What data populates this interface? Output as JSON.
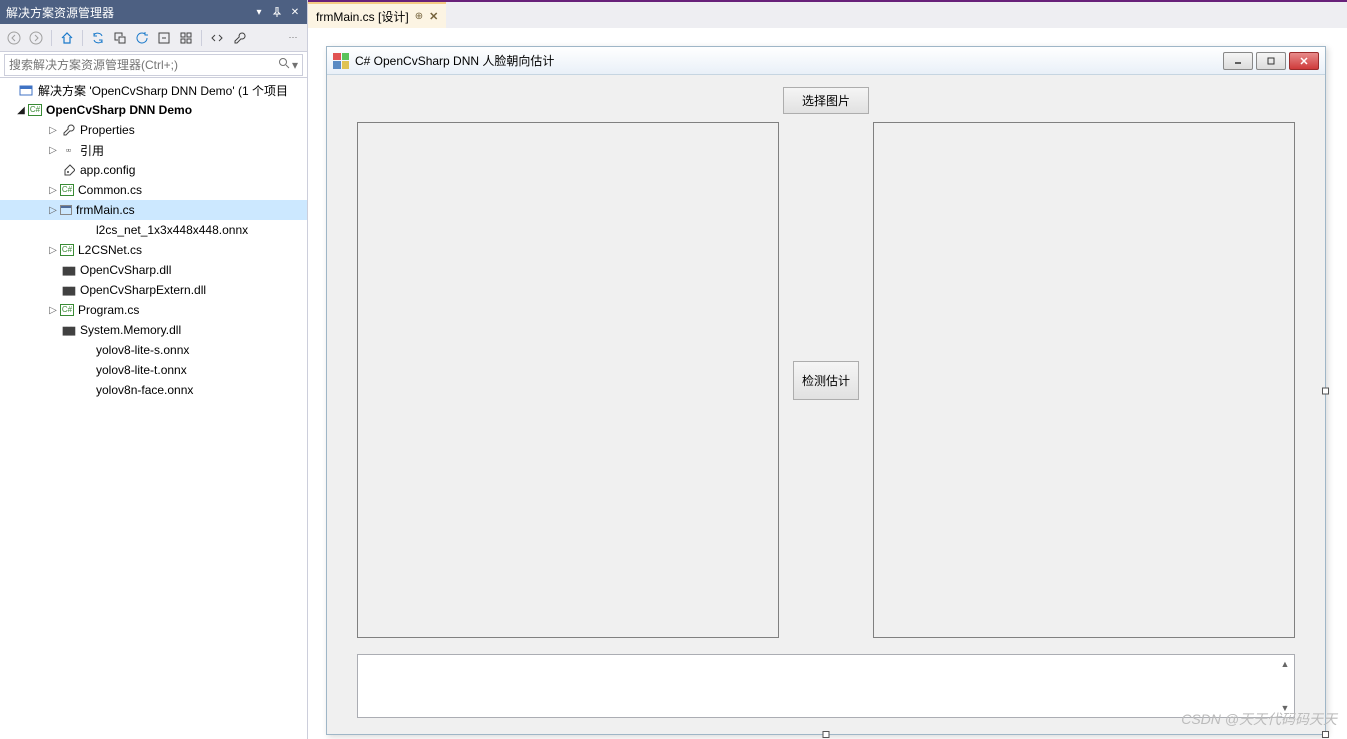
{
  "panel": {
    "title": "解决方案资源管理器",
    "search_placeholder": "搜索解决方案资源管理器(Ctrl+;)"
  },
  "tree": {
    "solution_label": "解决方案 'OpenCvSharp DNN Demo' (1 个项目",
    "project_label": "OpenCvSharp DNN Demo",
    "items": [
      {
        "label": "Properties",
        "icon": "wrench",
        "expander": "▷",
        "indent": 2
      },
      {
        "label": "引用",
        "icon": "ref",
        "expander": "▷",
        "indent": 2
      },
      {
        "label": "app.config",
        "icon": "config",
        "expander": "",
        "indent": 2
      },
      {
        "label": "Common.cs",
        "icon": "cs",
        "expander": "▷",
        "indent": 2
      },
      {
        "label": "frmMain.cs",
        "icon": "form",
        "expander": "▷",
        "indent": 2,
        "selected": true
      },
      {
        "label": "l2cs_net_1x3x448x448.onnx",
        "icon": "file",
        "expander": "",
        "indent": 3
      },
      {
        "label": "L2CSNet.cs",
        "icon": "cs",
        "expander": "▷",
        "indent": 2
      },
      {
        "label": "OpenCvSharp.dll",
        "icon": "dll",
        "expander": "",
        "indent": 2
      },
      {
        "label": "OpenCvSharpExtern.dll",
        "icon": "dll",
        "expander": "",
        "indent": 2
      },
      {
        "label": "Program.cs",
        "icon": "cs",
        "expander": "▷",
        "indent": 2
      },
      {
        "label": "System.Memory.dll",
        "icon": "dll",
        "expander": "",
        "indent": 2
      },
      {
        "label": "yolov8-lite-s.onnx",
        "icon": "file",
        "expander": "",
        "indent": 3
      },
      {
        "label": "yolov8-lite-t.onnx",
        "icon": "file",
        "expander": "",
        "indent": 3
      },
      {
        "label": "yolov8n-face.onnx",
        "icon": "file",
        "expander": "",
        "indent": 3
      }
    ]
  },
  "tabs": {
    "active": {
      "label": "frmMain.cs [设计]"
    }
  },
  "form": {
    "title": "C# OpenCvSharp DNN 人脸朝向估计",
    "btn_select_image": "选择图片",
    "btn_detect": "检测估计"
  },
  "watermark": "CSDN @天天代码码天天"
}
